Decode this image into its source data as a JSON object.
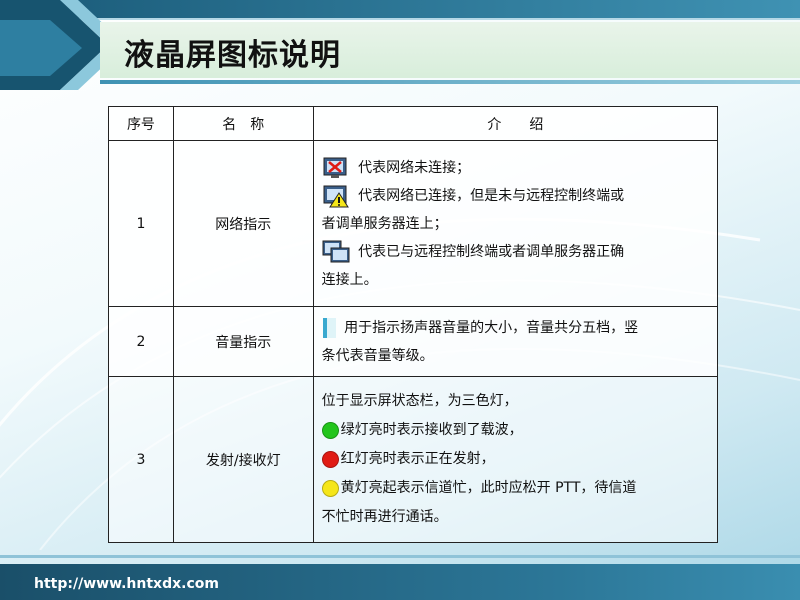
{
  "title": "液晶屏图标说明",
  "table": {
    "headers": {
      "index": "序号",
      "name": "名　称",
      "intro": "介　　绍"
    },
    "rows": [
      {
        "index": "1",
        "name": "网络指示",
        "lines": [
          "代表网络未连接；",
          "代表网络已连接，但是未与远程控制终端或",
          "者调单服务器连上；",
          "代表已与远程控制终端或者调单服务器正确",
          "连接上。"
        ]
      },
      {
        "index": "2",
        "name": "音量指示",
        "lines": [
          "用于指示扬声器音量的大小，音量共分五档，竖",
          "条代表音量等级。"
        ]
      },
      {
        "index": "3",
        "name": "发射/接收灯",
        "lines": [
          "位于显示屏状态栏，为三色灯，",
          "绿灯亮时表示接收到了载波，",
          "红灯亮时表示正在发射，",
          "黄灯亮起表示信道忙，此时应松开 PTT，待信道",
          "不忙时再进行通话。"
        ]
      }
    ]
  },
  "icons": {
    "network_disconnected": "network-disconnected-icon",
    "network_warning": "network-warning-icon",
    "network_connected": "network-connected-icon",
    "volume": "volume-icon"
  },
  "colors": {
    "green_light": "#22c51c",
    "red_light": "#e01b14",
    "yellow_light": "#f5e619",
    "header_bar": "#1a5a78"
  },
  "footer": {
    "url": "http://www.hntxdx.com"
  }
}
